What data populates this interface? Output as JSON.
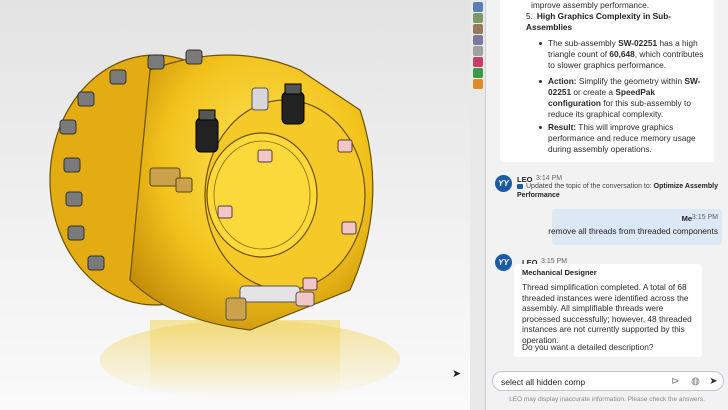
{
  "chat": {
    "prev_tail": "improve assembly performance.",
    "item5": {
      "number": "5.",
      "title": "High Graphics Complexity in Sub-Assemblies",
      "bullet1": {
        "t1": "The sub-assembly ",
        "b1": "SW-02251",
        "t2": " has a high triangle count of ",
        "b2": "60,648",
        "t3": ", which contributes to slower graphics performance."
      },
      "bullet2": {
        "label": "Action:",
        "t1": " Simplify the geometry within ",
        "b1": "SW-02251",
        "t2": " or create a ",
        "b2": "SpeedPak configuration",
        "t3": " for this sub-assembly to reduce its graphical complexity."
      },
      "bullet3": {
        "label": "Result:",
        "t1": " This will improve graphics performance and reduce memory usage during assembly operations."
      }
    },
    "leo_msg1": {
      "name": "LEO",
      "time": "3:14 PM",
      "topic_prefix": "Updated the topic of the conversation to: ",
      "topic": "Optimize Assembly Performance"
    },
    "user_msg": {
      "name": "Me",
      "time": "3:15 PM",
      "text": "remove all threads from threaded components"
    },
    "leo_msg2": {
      "name": "LEO",
      "time": "3:15 PM",
      "role": "Mechanical Designer",
      "text": "Thread simplification completed. A total of 68 threaded instances were identified across the assembly. All simplifiable threads were processed successfully; however, 48 threaded instances are not currently supported by this operation.",
      "question": "Do you want a detailed description?"
    },
    "input": {
      "value": "select all hidden comp"
    },
    "disclaimer": "LEO may display inaccurate information. Please check the answers.",
    "avatar_glyph": "YY"
  },
  "icons": {
    "send": "send-icon",
    "globe": "globe-icon",
    "attach": "attach-icon"
  },
  "colors": {
    "part_yellow": "#f2c21b",
    "accent_blue": "#1d5aa6",
    "user_bubble": "#dce8f4"
  }
}
